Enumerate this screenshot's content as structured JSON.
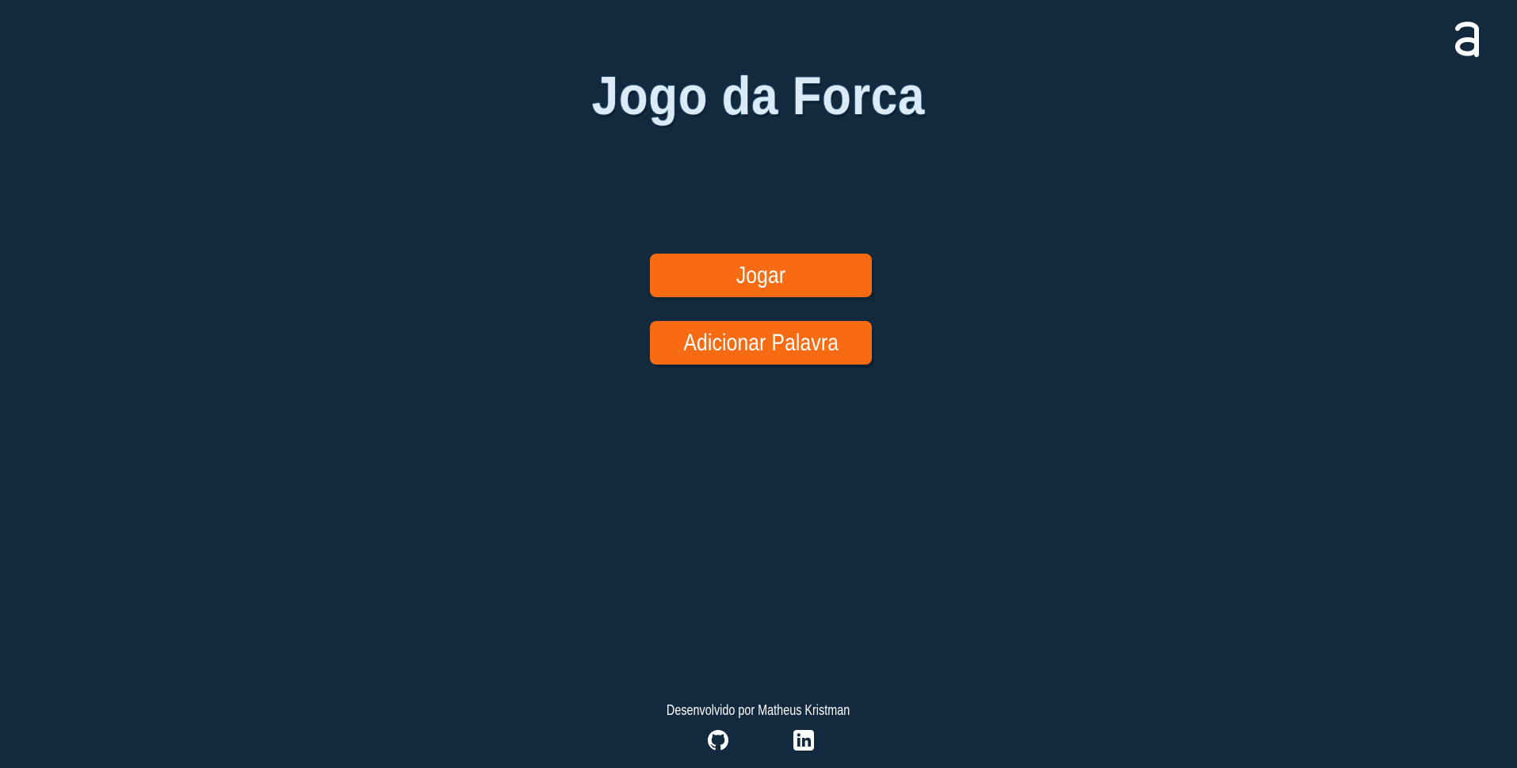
{
  "header": {
    "logo_icon": "a-logo-icon",
    "title": "Jogo da Forca"
  },
  "menu": {
    "play_label": "Jogar",
    "add_word_label": "Adicionar Palavra"
  },
  "footer": {
    "credit": "Desenvolvido por Matheus Kristman",
    "links": [
      {
        "icon": "github-icon"
      },
      {
        "icon": "linkedin-icon"
      }
    ]
  },
  "colors": {
    "background": "#13293d",
    "button": "#f76c12",
    "title": "#dbeaf7",
    "text": "#ffffff"
  }
}
